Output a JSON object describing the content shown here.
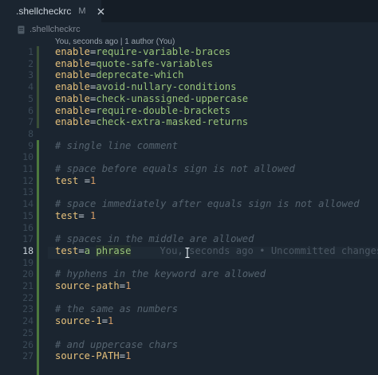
{
  "tab": {
    "label": ".shellcheckrc",
    "modified": "M"
  },
  "breadcrumb": {
    "label": ".shellcheckrc"
  },
  "blame_header": "You, seconds ago | 1 author (You)",
  "line_numbers": [
    "1",
    "2",
    "3",
    "4",
    "5",
    "6",
    "7",
    "8",
    "9",
    "10",
    "11",
    "12",
    "13",
    "14",
    "15",
    "16",
    "17",
    "18",
    "19",
    "20",
    "21",
    "22",
    "23",
    "24",
    "25",
    "26",
    "27"
  ],
  "active_line": "18",
  "lines": [
    {
      "k": "enable",
      "v": "require-variable-braces"
    },
    {
      "k": "enable",
      "v": "quote-safe-variables"
    },
    {
      "k": "enable",
      "v": "deprecate-which"
    },
    {
      "k": "enable",
      "v": "avoid-nullary-conditions"
    },
    {
      "k": "enable",
      "v": "check-unassigned-uppercase"
    },
    {
      "k": "enable",
      "v": "require-double-brackets"
    },
    {
      "k": "enable",
      "v": "check-extra-masked-returns"
    },
    {
      "blank": true
    },
    {
      "c": "# single line comment"
    },
    {
      "blank": true
    },
    {
      "c": "# space before equals sign is not allowed"
    },
    {
      "t": "test =1"
    },
    {
      "blank": true
    },
    {
      "c": "# space immediately after equals sign is not allowed"
    },
    {
      "t": "test= 1"
    },
    {
      "blank": true
    },
    {
      "c": "# spaces in the middle are allowed"
    },
    {
      "t": "test=a phrase",
      "blame": "You, seconds ago • Uncommitted changes"
    },
    {
      "blank": true
    },
    {
      "c": "# hyphens in the keyword are allowed"
    },
    {
      "k": "source-path",
      "v": "1"
    },
    {
      "blank": true
    },
    {
      "c": "# the same as numbers"
    },
    {
      "k": "source-1",
      "v": "1"
    },
    {
      "blank": true
    },
    {
      "c": "# and uppercase chars"
    },
    {
      "k": "source-PATH",
      "v": "1"
    }
  ]
}
